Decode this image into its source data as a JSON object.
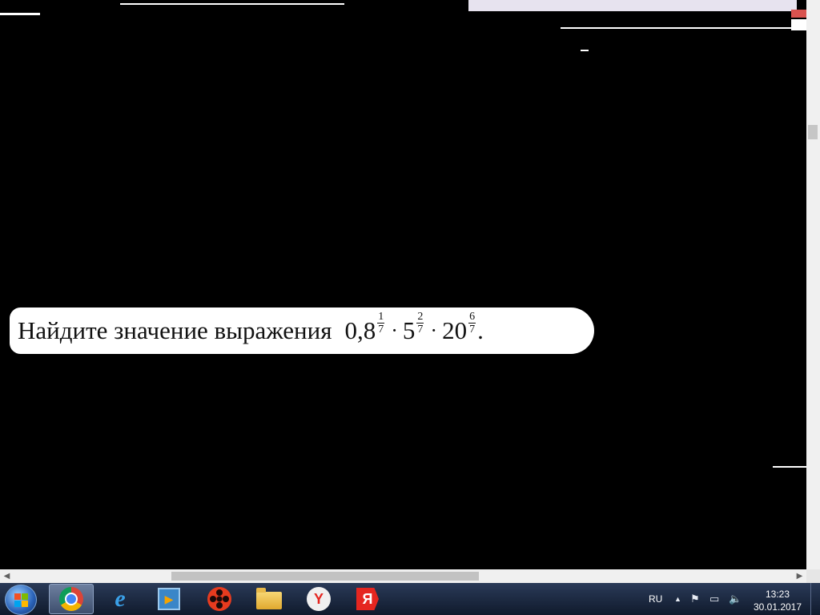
{
  "task": {
    "prefix": "Найдите значение выражения",
    "terms": [
      {
        "base": "0,8",
        "num": "1",
        "den": "7"
      },
      {
        "base": "5",
        "num": "2",
        "den": "7"
      },
      {
        "base": "20",
        "num": "6",
        "den": "7"
      }
    ],
    "dot": "·",
    "end": "."
  },
  "scrollbar": {
    "left_arrow": "◀",
    "right_arrow": "▶"
  },
  "taskbar": {
    "apps": [
      {
        "name": "chrome",
        "icon": "chrome-icon",
        "active": true
      },
      {
        "name": "internet-explorer",
        "icon": "ie-icon"
      },
      {
        "name": "media-player",
        "icon": "media-player-icon"
      },
      {
        "name": "video-app",
        "icon": "reel-icon"
      },
      {
        "name": "file-explorer",
        "icon": "folder-icon"
      },
      {
        "name": "yandex-browser",
        "icon": "yandex-browser-icon"
      },
      {
        "name": "yandex",
        "icon": "yandex-icon"
      }
    ],
    "tray": {
      "language": "RU",
      "time": "13:23",
      "date": "30.01.2017"
    }
  }
}
